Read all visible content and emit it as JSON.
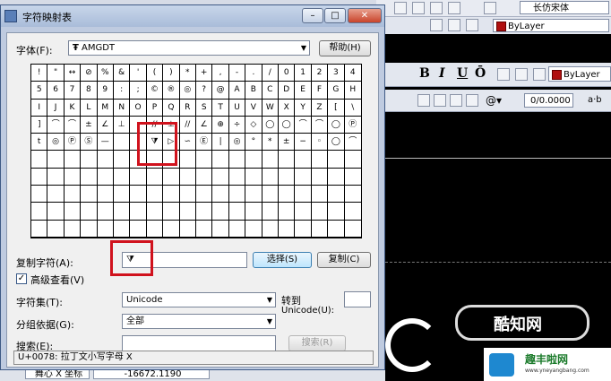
{
  "cad": {
    "font_name": "长仿宋体",
    "layer_top": "ByLayer",
    "layer_format": "ByLayer",
    "bold": "B",
    "italic": "I",
    "underline": "U",
    "overline": "Ō",
    "at_symbol": "@▾",
    "oblique_value": "0/0.0000",
    "ab_label": "a·b",
    "status": {
      "coord_label": "舞心 X 坐标",
      "coord_value": "-16672.1190"
    }
  },
  "watermark": {
    "text": "酷知网",
    "site_title": "趣丰啦网",
    "site_url": "www.yneyangbang.com"
  },
  "dialog": {
    "title": "字符映射表",
    "minimize": "–",
    "maximize": "□",
    "close": "✕",
    "font_label": "字体(F):",
    "font_value": "AMGDT",
    "font_icon": "Ŧ",
    "help_button": "帮助(H)",
    "grid_rows": [
      [
        "!",
        "\"",
        "↔",
        "⊘",
        "%",
        "&",
        "'",
        "(",
        ")",
        "*",
        "+",
        ",",
        "-",
        ".",
        "/",
        "0",
        "1",
        "2",
        "3",
        "4"
      ],
      [
        "5",
        "6",
        "7",
        "8",
        "9",
        ":",
        ";",
        "©",
        "®",
        "◎",
        "?",
        "@",
        "A",
        "B",
        "C",
        "D",
        "E",
        "F",
        "G",
        "H"
      ],
      [
        "I",
        "J",
        "K",
        "L",
        "M",
        "N",
        "O",
        "P",
        "Q",
        "R",
        "S",
        "T",
        "U",
        "V",
        "W",
        "X",
        "Y",
        "Z",
        "[",
        "\\"
      ],
      [
        "]",
        "⌒",
        "⌒",
        "±",
        "∠",
        "⊥",
        "",
        "//",
        "⊥",
        "//",
        "∠",
        "⊕",
        "÷",
        "◇",
        "◯",
        "◯",
        "⌒",
        "⌒",
        "◯",
        "Ⓟ"
      ],
      [
        "t",
        "◎",
        "Ⓟ",
        "Ⓢ",
        "—",
        "",
        "",
        "⧩",
        "▷",
        "∽",
        "Ⓔ",
        "|",
        "◎",
        "°",
        "*",
        "±",
        "−",
        "◦",
        "◯",
        "⌒"
      ],
      [
        "",
        "",
        "",
        "",
        "",
        "",
        "",
        "",
        "",
        "",
        "",
        "",
        "",
        "",
        "",
        "",
        "",
        "",
        "",
        ""
      ],
      [
        "",
        "",
        "",
        "",
        "",
        "",
        "",
        "",
        "",
        "",
        "",
        "",
        "",
        "",
        "",
        "",
        "",
        "",
        "",
        ""
      ],
      [
        "",
        "",
        "",
        "",
        "",
        "",
        "",
        "",
        "",
        "",
        "",
        "",
        "",
        "",
        "",
        "",
        "",
        "",
        "",
        ""
      ],
      [
        "",
        "",
        "",
        "",
        "",
        "",
        "",
        "",
        "",
        "",
        "",
        "",
        "",
        "",
        "",
        "",
        "",
        "",
        "",
        ""
      ],
      [
        "",
        "",
        "",
        "",
        "",
        "",
        "",
        "",
        "",
        "",
        "",
        "",
        "",
        "",
        "",
        "",
        "",
        "",
        "",
        ""
      ]
    ],
    "copy_label": "复制字符(A):",
    "copy_value": "⧩",
    "select_button": "选择(S)",
    "copy_button": "复制(C)",
    "advanced_checked": "✓",
    "advanced_label": "高级查看(V)",
    "charset_label": "字符集(T):",
    "charset_value": "Unicode",
    "goto_label": "转到",
    "goto_sublabel": "Unicode(U):",
    "groupby_label": "分组依据(G):",
    "groupby_value": "全部",
    "search_label": "搜索(E):",
    "search_button": "搜索(R)",
    "status_text": "U+0078: 拉丁文小写字母 X"
  }
}
